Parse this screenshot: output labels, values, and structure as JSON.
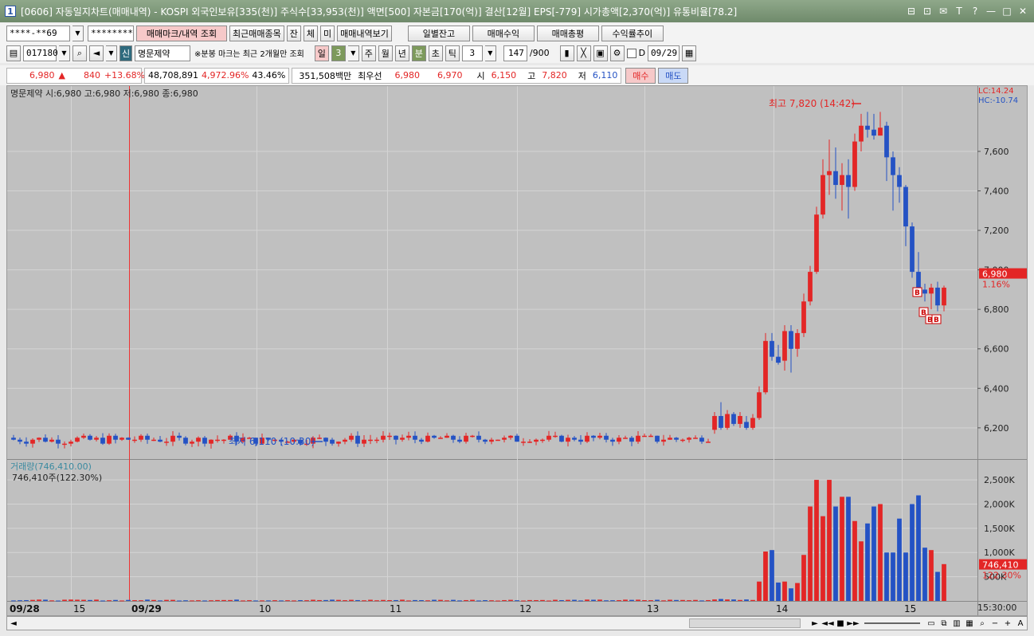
{
  "window": {
    "app_icon": "1",
    "title": "[0606] 자동일지차트(매매내역) - KOSPI 외국인보유[335(천)] 주식수[33,953(천)] 액면[500] 자본금[170(억)] 결산[12월] EPS[-779] 시가총액[2,370(억)] 유통비율[78.2]",
    "controls": [
      "⊟",
      "⊡",
      "✉",
      "T",
      "?",
      "—",
      "□",
      "✕"
    ]
  },
  "toolbar1": {
    "account": "****-**69",
    "password": "********",
    "buttons": [
      "매매마크/내역 조회",
      "최근매매종목",
      "잔",
      "체",
      "미",
      "매매내역보기"
    ],
    "right_buttons": [
      "일별잔고",
      "매매수익",
      "매매총평",
      "수익률추이"
    ]
  },
  "toolbar2": {
    "code": "017180",
    "badge": "신",
    "stock_name": "명문제약",
    "note": "※분봉 마크는 최근 2개월만 조회",
    "period_tabs": [
      "일",
      "3",
      "주",
      "월",
      "년",
      "분",
      "초",
      "틱"
    ],
    "interval": "3",
    "count": "147",
    "count_max": "/900",
    "date": "09/29",
    "d_label": "D"
  },
  "quote": {
    "price": "6,980",
    "arrow": "▲",
    "change": "840",
    "change_pct": "+13.68%",
    "volume": "48,708,891",
    "volume_pct": "4,972.96%",
    "ratio": "43.46%",
    "amount": "351,508백만",
    "bid_label": "최우선",
    "ask": "6,980",
    "bid": "6,970",
    "open_label": "시",
    "open": "6,150",
    "high_label": "고",
    "high": "7,820",
    "low_label": "저",
    "low": "6,110",
    "buy": "매수",
    "sell": "매도"
  },
  "price_panel": {
    "legend": "명문제약 시:6,980 고:6,980 저:6,980 종:6,980",
    "lc": "LC:14.24",
    "hc": "HC:-10.74",
    "high_note": "최고 7,820 (14:42)",
    "low_note": "최저 6,110 (10:30)",
    "current_price": "6,980",
    "current_pct": "1.16%",
    "axis": [
      "7,600",
      "7,400",
      "7,200",
      "7,000",
      "6,800",
      "6,600",
      "6,400",
      "6,200"
    ]
  },
  "volume_panel": {
    "legend": "거래량(746,410.00)",
    "sub": "746,410주(122.30%)",
    "current": "746,410",
    "current_pct": "122.30%",
    "axis": [
      "2,500K",
      "2,000K",
      "1,500K",
      "1,000K",
      "500K"
    ]
  },
  "x_axis": [
    "09/28",
    "15",
    "09/29",
    "10",
    "11",
    "12",
    "13",
    "14",
    "15"
  ],
  "time_label": "15:30:00",
  "colors": {
    "up": "#e32626",
    "down": "#2452c4",
    "panel": "#c0c0c0",
    "title": "#7b957a"
  },
  "chart_data": {
    "type": "candlestick",
    "x_labels": [
      "09/28",
      "15",
      "09/29",
      "10",
      "11",
      "12",
      "13",
      "14",
      "15"
    ],
    "ylim": [
      6050,
      7850
    ],
    "vol_lim": [
      0,
      2600000
    ],
    "candles_note": "flat ~6,140 to 13h, rally 13:30–14:42 to 7,820 high, pullback to 6,980",
    "rally": [
      [
        6190,
        6260,
        6280,
        6170
      ],
      [
        6260,
        6200,
        6330,
        6190
      ],
      [
        6200,
        6270,
        6290,
        6190
      ],
      [
        6270,
        6220,
        6280,
        6210
      ],
      [
        6220,
        6260,
        6280,
        6200
      ],
      [
        6230,
        6200,
        6260,
        6190
      ],
      [
        6200,
        6250,
        6270,
        6190
      ],
      [
        6250,
        6380,
        6410,
        6240
      ],
      [
        6380,
        6640,
        6680,
        6370
      ],
      [
        6640,
        6560,
        6680,
        6540
      ],
      [
        6560,
        6530,
        6620,
        6520
      ],
      [
        6540,
        6690,
        6720,
        6490
      ],
      [
        6690,
        6600,
        6720,
        6480
      ],
      [
        6600,
        6680,
        6700,
        6560
      ],
      [
        6680,
        6840,
        6880,
        6660
      ],
      [
        6840,
        6990,
        7020,
        6820
      ],
      [
        6990,
        7280,
        7320,
        6980
      ],
      [
        7280,
        7480,
        7560,
        7260
      ],
      [
        7480,
        7500,
        7660,
        7380
      ],
      [
        7500,
        7430,
        7620,
        7360
      ],
      [
        7430,
        7480,
        7540,
        7300
      ],
      [
        7480,
        7420,
        7560,
        7260
      ],
      [
        7420,
        7650,
        7690,
        7400
      ],
      [
        7650,
        7730,
        7790,
        7600
      ],
      [
        7730,
        7710,
        7800,
        7670
      ],
      [
        7710,
        7680,
        7790,
        7660
      ],
      [
        7680,
        7720,
        7800,
        7680
      ],
      [
        7730,
        7570,
        7750,
        7450
      ],
      [
        7570,
        7480,
        7600,
        7300
      ],
      [
        7480,
        7420,
        7520,
        7340
      ],
      [
        7420,
        7220,
        7430,
        7120
      ],
      [
        7220,
        6990,
        7240,
        6960
      ],
      [
        6990,
        6900,
        7090,
        6880
      ],
      [
        6900,
        6880,
        6930,
        6840
      ],
      [
        6880,
        6910,
        6930,
        6800
      ],
      [
        6910,
        6820,
        6940,
        6790
      ],
      [
        6820,
        6910,
        6920,
        6790
      ]
    ],
    "rally_volume": [
      30000,
      40000,
      30000,
      30000,
      20000,
      30000,
      20000,
      400000,
      1020000,
      1050000,
      380000,
      400000,
      260000,
      370000,
      950000,
      1950000,
      2500000,
      1750000,
      2500000,
      1950000,
      2150000,
      2150000,
      1650000,
      1230000,
      1600000,
      1950000,
      2000000,
      1000000,
      1000000,
      1700000,
      1000000,
      2000000,
      2180000,
      1100000,
      1050000,
      600000,
      760000
    ]
  }
}
